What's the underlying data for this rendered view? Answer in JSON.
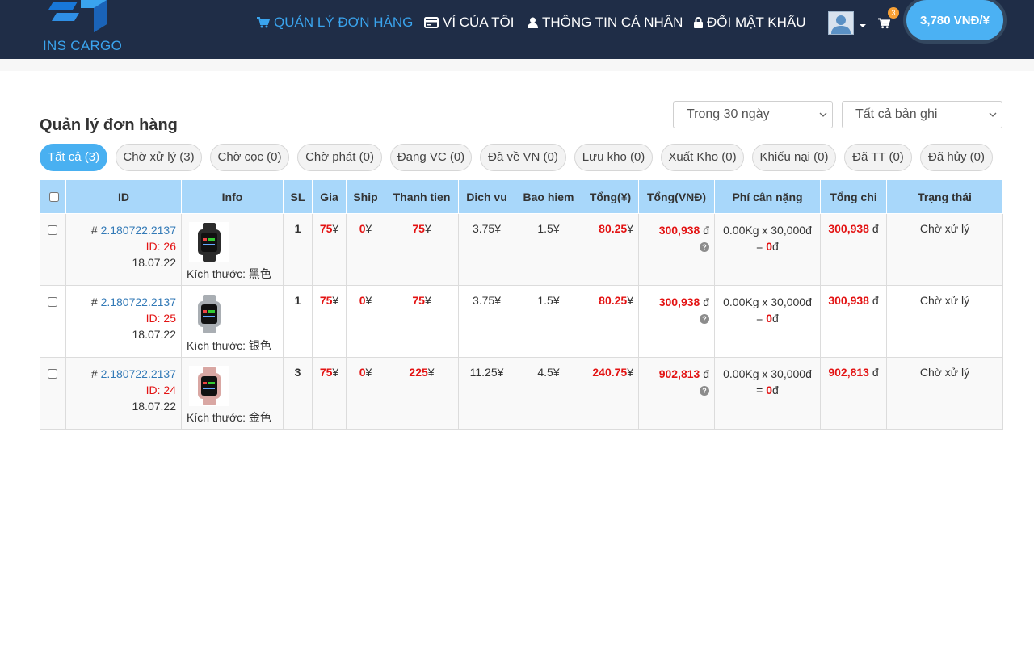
{
  "brand": {
    "logo_text": "INS CARGO"
  },
  "nav": {
    "items": [
      {
        "label": "QUẢN LÝ ĐƠN HÀNG",
        "icon": "cart-icon",
        "active": true
      },
      {
        "label": "VÍ CỦA TÔI",
        "icon": "credit-card-icon",
        "active": false
      },
      {
        "label": "THÔNG TIN CÁ NHÂN",
        "icon": "user-icon",
        "active": false
      },
      {
        "label": "ĐỔI MẬT KHẨU",
        "icon": "lock-icon",
        "active": false
      }
    ],
    "cart_count": "3",
    "balance": "3,780 VNĐ/¥"
  },
  "page": {
    "title": "Quản lý đơn hàng",
    "filter_period": "Trong 30 ngày",
    "filter_records": "Tất cả bản ghi"
  },
  "tabs": [
    "Tất cả (3)",
    "Chờ xử lý (3)",
    "Chờ cọc (0)",
    "Chờ phát (0)",
    "Đang VC (0)",
    "Đã về VN (0)",
    "Lưu kho (0)",
    "Xuất Kho (0)",
    "Khiếu nại (0)",
    "Đã TT (0)",
    "Đã hủy (0)"
  ],
  "table": {
    "headers": [
      "ID",
      "Info",
      "SL",
      "Gia",
      "Ship",
      "Thanh tien",
      "Dich vu",
      "Bao hiem",
      "Tổng(¥)",
      "Tổng(VNĐ)",
      "Phí cân nặng",
      "Tổng chi",
      "Trạng thái"
    ],
    "rows": [
      {
        "hash": "#",
        "code": "2.180722.2137",
        "id": "ID: 26",
        "date": "18.07.22",
        "info": "Kích thước: 黑色",
        "qty": "1",
        "price": "75",
        "ship": "0",
        "subtotal": "75",
        "service": "3.75¥",
        "insurance": "1.5¥",
        "total_cny": "80.25",
        "total_vnd": "300,938",
        "weight": "0.00Kg x 30,000đ",
        "weight_eq": "=",
        "weight_fee": "0",
        "total_spend": "300,938",
        "status": "Chờ xử lý",
        "swatch": "#2b2b2b"
      },
      {
        "hash": "#",
        "code": "2.180722.2137",
        "id": "ID: 25",
        "date": "18.07.22",
        "info": "Kích thước: 银色",
        "qty": "1",
        "price": "75",
        "ship": "0",
        "subtotal": "75",
        "service": "3.75¥",
        "insurance": "1.5¥",
        "total_cny": "80.25",
        "total_vnd": "300,938",
        "weight": "0.00Kg x 30,000đ",
        "weight_eq": "=",
        "weight_fee": "0",
        "total_spend": "300,938",
        "status": "Chờ xử lý",
        "swatch": "#a9aeb3"
      },
      {
        "hash": "#",
        "code": "2.180722.2137",
        "id": "ID: 24",
        "date": "18.07.22",
        "info": "Kích thước: 金色",
        "qty": "3",
        "price": "75",
        "ship": "0",
        "subtotal": "225",
        "service": "11.25¥",
        "insurance": "4.5¥",
        "total_cny": "240.75",
        "total_vnd": "902,813",
        "weight": "0.00Kg x 30,000đ",
        "weight_eq": "=",
        "weight_fee": "0",
        "total_spend": "902,813",
        "status": "Chờ xử lý",
        "swatch": "#d9a7a3"
      }
    ]
  },
  "colors": {
    "navbar": "#1f2d47",
    "accent": "#3aa4ee",
    "header_row": "#a8d7fa",
    "money_red": "#e31313"
  }
}
